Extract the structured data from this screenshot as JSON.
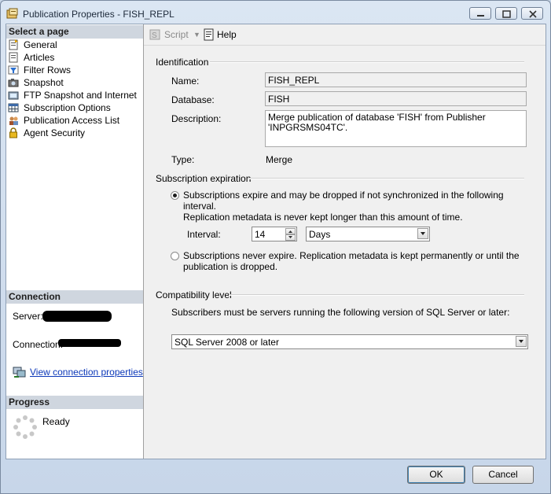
{
  "window": {
    "title": "Publication Properties - FISH_REPL"
  },
  "left": {
    "select_page_header": "Select a page",
    "pages": [
      {
        "label": "General",
        "icon": "page-icon"
      },
      {
        "label": "Articles",
        "icon": "page-icon"
      },
      {
        "label": "Filter Rows",
        "icon": "filter-icon"
      },
      {
        "label": "Snapshot",
        "icon": "camera-icon"
      },
      {
        "label": "FTP Snapshot and Internet",
        "icon": "ftp-icon"
      },
      {
        "label": "Subscription Options",
        "icon": "grid-icon"
      },
      {
        "label": "Publication Access List",
        "icon": "users-icon"
      },
      {
        "label": "Agent Security",
        "icon": "lock-icon"
      }
    ],
    "connection_header": "Connection",
    "server_label": "Server:",
    "connection_label": "Connection:",
    "view_connection_link": "View connection properties",
    "progress_header": "Progress",
    "progress_status": "Ready"
  },
  "toolbar": {
    "script_label": "Script",
    "help_label": "Help"
  },
  "identification": {
    "header": "Identification",
    "name_label": "Name:",
    "name_value": "FISH_REPL",
    "database_label": "Database:",
    "database_value": "FISH",
    "description_label": "Description:",
    "description_value": "Merge publication of database 'FISH' from Publisher 'INPGRSMS04TC'.",
    "type_label": "Type:",
    "type_value": "Merge"
  },
  "expiration": {
    "header": "Subscription expiration",
    "option_expire_line1": "Subscriptions expire and may be dropped if not synchronized in the following interval.",
    "option_expire_line2": "Replication metadata is never kept longer than this amount of time.",
    "interval_label": "Interval:",
    "interval_value": "14",
    "interval_unit": "Days",
    "option_never_line1": "Subscriptions never expire. Replication metadata is kept permanently or until the",
    "option_never_line2": "publication is dropped.",
    "selected_option": "expire"
  },
  "compatibility": {
    "header": "Compatibility level",
    "description": "Subscribers must be servers running the following version of SQL Server or later:",
    "selected_value": "SQL Server 2008 or later"
  },
  "buttons": {
    "ok": "OK",
    "cancel": "Cancel"
  }
}
